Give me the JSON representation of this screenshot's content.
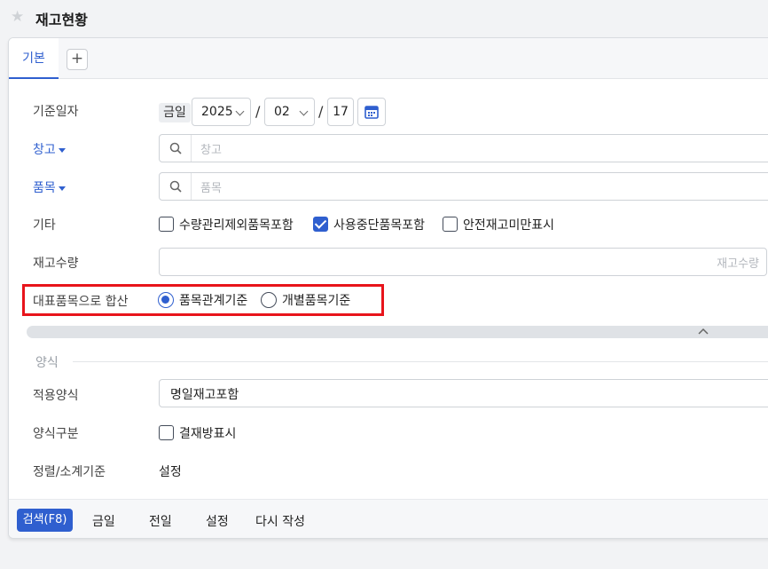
{
  "header": {
    "title": "재고현황"
  },
  "tabs": {
    "active": "기본",
    "add": "+"
  },
  "form": {
    "base_date": {
      "label": "기준일자",
      "today_tag": "금일",
      "year": "2025",
      "month": "02",
      "day": "17",
      "separator": "/"
    },
    "warehouse": {
      "label": "창고",
      "placeholder": "창고"
    },
    "item": {
      "label": "품목",
      "placeholder": "품목"
    },
    "etc": {
      "label": "기타",
      "options": [
        {
          "label": "수량관리제외품목포함",
          "checked": false
        },
        {
          "label": "사용중단품목포함",
          "checked": true
        },
        {
          "label": "안전재고미만표시",
          "checked": false
        }
      ]
    },
    "stock_qty": {
      "label": "재고수량",
      "placeholder": "재고수량"
    },
    "combine": {
      "label": "대표품목으로 합산",
      "options": [
        {
          "label": "품목관계기준",
          "selected": true
        },
        {
          "label": "개별품목기준",
          "selected": false
        }
      ]
    }
  },
  "format_section": {
    "title": "양식",
    "apply_format": {
      "label": "적용양식",
      "value": "명일재고포함"
    },
    "format_type": {
      "label": "양식구분",
      "option": "결재방표시"
    },
    "sort": {
      "label": "정렬/소계기준",
      "value": "설정"
    }
  },
  "footer": {
    "search": "검색(F8)",
    "today": "금일",
    "prev_day": "전일",
    "settings": "설정",
    "rewrite": "다시 작성"
  },
  "colors": {
    "accent": "#2f5fcf",
    "highlight": "#e8141b"
  }
}
